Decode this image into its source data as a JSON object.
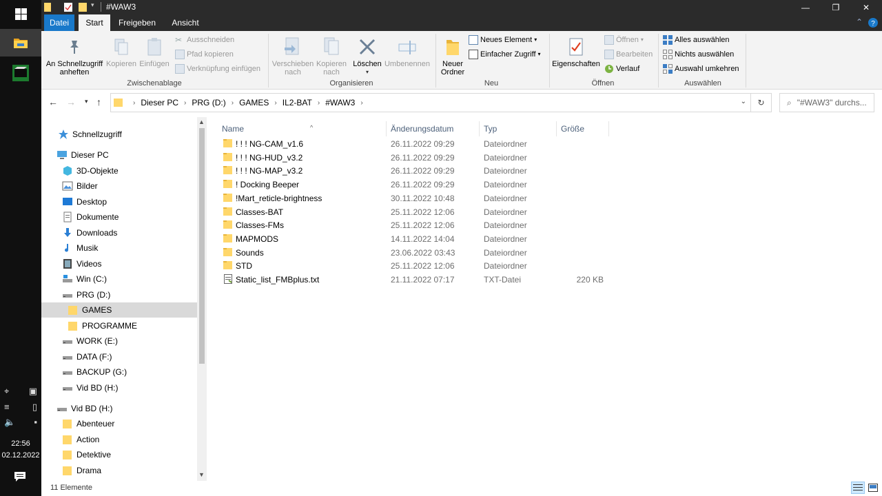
{
  "window": {
    "title": "#WAW3",
    "minimize": "—",
    "maximize": "❐",
    "close": "✕"
  },
  "ribbon_tabs": [
    {
      "label": "Datei"
    },
    {
      "label": "Start"
    },
    {
      "label": "Freigeben"
    },
    {
      "label": "Ansicht"
    }
  ],
  "ribbon": {
    "zwischenablage": {
      "label": "Zwischenablage",
      "pin": "An Schnellzugriff anheften",
      "copy": "Kopieren",
      "paste": "Einfügen",
      "cut": "Ausschneiden",
      "copy_path": "Pfad kopieren",
      "paste_shortcut": "Verknüpfung einfügen"
    },
    "organisieren": {
      "label": "Organisieren",
      "move_to": "Verschieben nach",
      "copy_to": "Kopieren nach",
      "delete": "Löschen",
      "rename": "Umbenennen"
    },
    "neu": {
      "label": "Neu",
      "new_folder": "Neuer Ordner",
      "new_item": "Neues Element",
      "easy_access": "Einfacher Zugriff"
    },
    "oeffnen": {
      "label": "Öffnen",
      "properties": "Eigenschaften",
      "open": "Öffnen",
      "edit": "Bearbeiten",
      "history": "Verlauf"
    },
    "auswaehlen": {
      "label": "Auswählen",
      "select_all": "Alles auswählen",
      "select_none": "Nichts auswählen",
      "invert": "Auswahl umkehren"
    }
  },
  "address": {
    "crumbs": [
      "Dieser PC",
      "PRG (D:)",
      "GAMES",
      "IL2-BAT",
      "#WAW3"
    ],
    "search_placeholder": "\"#WAW3\" durchs..."
  },
  "navpane": {
    "items": [
      {
        "label": "Schnellzugriff"
      },
      {
        "label": "Dieser PC"
      },
      {
        "label": "3D-Objekte"
      },
      {
        "label": "Bilder"
      },
      {
        "label": "Desktop"
      },
      {
        "label": "Dokumente"
      },
      {
        "label": "Downloads"
      },
      {
        "label": "Musik"
      },
      {
        "label": "Videos"
      },
      {
        "label": "Win (C:)"
      },
      {
        "label": "PRG (D:)"
      },
      {
        "label": "GAMES"
      },
      {
        "label": "PROGRAMME"
      },
      {
        "label": "WORK (E:)"
      },
      {
        "label": "DATA (F:)"
      },
      {
        "label": "BACKUP (G:)"
      },
      {
        "label": "Vid BD (H:)"
      },
      {
        "label": "Vid BD (H:)"
      },
      {
        "label": "Abenteuer"
      },
      {
        "label": "Action"
      },
      {
        "label": "Detektive"
      },
      {
        "label": "Drama"
      }
    ]
  },
  "columns": {
    "name": "Name",
    "date": "Änderungsdatum",
    "type": "Typ",
    "size": "Größe"
  },
  "files": [
    {
      "name": "! ! ! NG-CAM_v1.6",
      "date": "26.11.2022 09:29",
      "type": "Dateiordner",
      "size": ""
    },
    {
      "name": "! ! ! NG-HUD_v3.2",
      "date": "26.11.2022 09:29",
      "type": "Dateiordner",
      "size": ""
    },
    {
      "name": "! ! ! NG-MAP_v3.2",
      "date": "26.11.2022 09:29",
      "type": "Dateiordner",
      "size": ""
    },
    {
      "name": "! Docking Beeper",
      "date": "26.11.2022 09:29",
      "type": "Dateiordner",
      "size": ""
    },
    {
      "name": "!Mart_reticle-brightness",
      "date": "30.11.2022 10:48",
      "type": "Dateiordner",
      "size": ""
    },
    {
      "name": "Classes-BAT",
      "date": "25.11.2022 12:06",
      "type": "Dateiordner",
      "size": ""
    },
    {
      "name": "Classes-FMs",
      "date": "25.11.2022 12:06",
      "type": "Dateiordner",
      "size": ""
    },
    {
      "name": "MAPMODS",
      "date": "14.11.2022 14:04",
      "type": "Dateiordner",
      "size": ""
    },
    {
      "name": "Sounds",
      "date": "23.06.2022 03:43",
      "type": "Dateiordner",
      "size": ""
    },
    {
      "name": "STD",
      "date": "25.11.2022 12:06",
      "type": "Dateiordner",
      "size": ""
    },
    {
      "name": "Static_list_FMBplus.txt",
      "date": "21.11.2022 07:17",
      "type": "TXT-Datei",
      "size": "220 KB"
    }
  ],
  "status": {
    "count": "11 Elemente"
  },
  "taskbar": {
    "time": "22:56",
    "date": "02.12.2022"
  },
  "colors": {
    "accent": "#1979ca",
    "folder": "#ffd76b",
    "titlebar": "#2b2b2b"
  }
}
